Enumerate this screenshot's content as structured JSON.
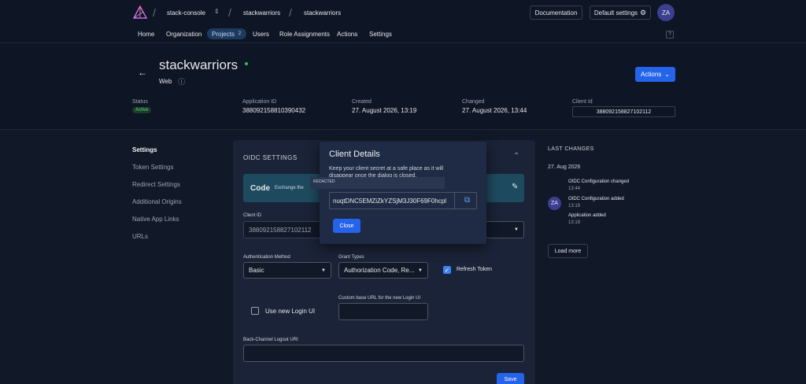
{
  "header": {
    "org": "stack-console",
    "project": "stackwarriors",
    "app": "stackwarriors",
    "docs": "Documentation",
    "default_settings": "Default settings",
    "avatar": "ZA",
    "help": "?"
  },
  "nav": {
    "home": "Home",
    "organization": "Organization",
    "projects": "Projects",
    "projects_count": "2",
    "users": "Users",
    "role_assignments": "Role Assignments",
    "actions": "Actions",
    "settings": "Settings"
  },
  "app": {
    "title": "stackwarriors",
    "type": "Web",
    "actions_btn": "Actions",
    "status_label": "Status",
    "status_value": "Active",
    "app_id_label": "Application ID",
    "app_id_value": "388092158810390432",
    "created_label": "Created",
    "created_value": "27. August 2026, 13:19",
    "changed_label": "Changed",
    "changed_value": "27. August 2026, 13:44",
    "client_id_label": "Client Id",
    "client_id_value": "388092158827102112"
  },
  "sidebar": {
    "items": [
      "Settings",
      "Token Settings",
      "Redirect Settings",
      "Additional Origins",
      "Native App Links",
      "URLs"
    ]
  },
  "oidc": {
    "title": "OIDC SETTINGS",
    "code_label": "Code",
    "code_desc": "Exchange the",
    "client_id_label": "Client ID",
    "client_id_value": "388092158827102112",
    "auth_method_label": "Authentication Method",
    "auth_method_value": "Basic",
    "grant_types_label": "Grant Types",
    "grant_types_value": "Authorization Code, Re...",
    "refresh_token": "Refresh Token",
    "use_new_login": "Use new Login UI",
    "custom_url_label": "Custom base URL for the new Login UI",
    "backchannel_label": "Back-Channel Logout URI",
    "save": "Save"
  },
  "dialog": {
    "title": "Client Details",
    "message": "Keep your client secret at a safe place as it will disappear once the dialog is closed.",
    "redacted": "REDACTED",
    "secret": "nuqtDNC5EMZiZkYZSjM3J30F69F0hcpl",
    "close": "Close"
  },
  "changes": {
    "title": "LAST CHANGES",
    "date": "27. Aug 2026",
    "avatar": "ZA",
    "entries": [
      {
        "text": "OIDC Configuration changed",
        "time": "13:44"
      },
      {
        "text": "OIDC Configuration added",
        "time": "13:19"
      },
      {
        "text": "Application added",
        "time": "13:19"
      }
    ],
    "load_more": "Load more"
  },
  "colors": {
    "accent": "#2563eb",
    "active_badge_bg": "#1e3a2a",
    "active_badge_text": "#4ade80",
    "code_card": "#1e4a5f"
  }
}
